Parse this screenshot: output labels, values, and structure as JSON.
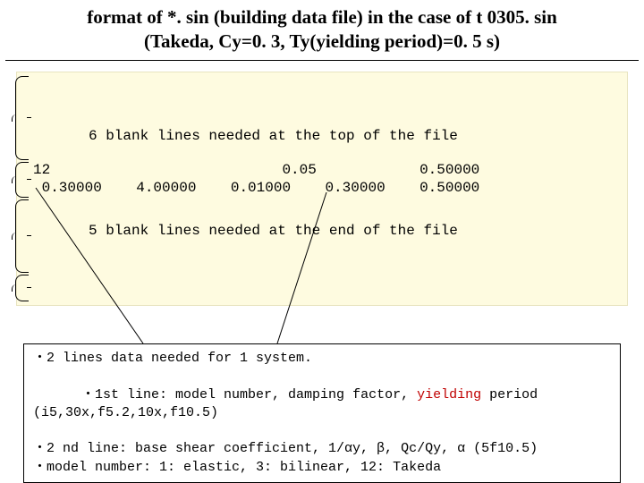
{
  "title_line1": "format of *. sin (building data file) in the case of t 0305. sin",
  "title_line2": "(Takeda, Cy=0. 3, Ty(yielding period)=0. 5 s)",
  "file": {
    "top_note": "6 blank lines needed at the top of the file",
    "data_line1": "12                           0.05            0.50000",
    "data_line2": " 0.30000    4.00000    0.01000    0.30000    0.50000",
    "bottom_note": "5 blank lines needed at the end of the file"
  },
  "legend": {
    "l1": "・2 lines data needed for 1 system.",
    "l2a": "・1st line: model number, damping factor, ",
    "l2b": "yielding",
    "l2c": " period (i5,30x,f5.2,10x,f10.5)",
    "l3": "・2 nd line: base shear coefficient, 1/αy, β, Qc/Qy, α (5f10.5)",
    "l4": "・model number: 1: elastic, 3: bilinear, 12: Takeda"
  }
}
